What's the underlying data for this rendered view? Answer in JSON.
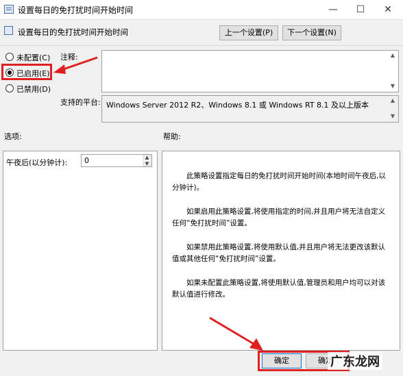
{
  "window": {
    "title": "设置每日的免打扰时间开始时间",
    "minimize": "—",
    "maximize": "☐",
    "close": "✕"
  },
  "header": {
    "title": "设置每日的免打扰时间开始时间",
    "prev_label": "上一个设置(P)",
    "next_label": "下一个设置(N)"
  },
  "state": {
    "options": [
      {
        "label": "未配置(C)",
        "selected": false
      },
      {
        "label": "已启用(E)",
        "selected": true
      },
      {
        "label": "已禁用(D)",
        "selected": false
      }
    ]
  },
  "comment": {
    "label": "注释:",
    "value": ""
  },
  "platform": {
    "label": "支持的平台:",
    "value": "Windows Server 2012 R2、Windows 8.1 或 Windows RT 8.1 及以上版本"
  },
  "options_panel": {
    "heading": "选项:",
    "field_label": "午夜后(以分钟计):",
    "field_value": "0"
  },
  "help_panel": {
    "heading": "帮助:",
    "paragraphs": [
      "此策略设置指定每日的免打扰时间开始时间(本地时间午夜后,以分钟计)。",
      "如果启用此策略设置,将使用指定的时间,并且用户将无法自定义任何“免打扰时间”设置。",
      "如果禁用此策略设置,将使用默认值,并且用户将无法更改该默认值或其他任何“免打扰时间”设置。",
      "如果未配置此策略设置,将使用默认值,管理员和用户均可以对该默认值进行修改。"
    ]
  },
  "footer": {
    "ok_label": "确定",
    "cancel_partial": "确定"
  },
  "watermark": {
    "text": "广东龙网"
  },
  "annotations": {
    "highlight_color": "#e02020"
  }
}
